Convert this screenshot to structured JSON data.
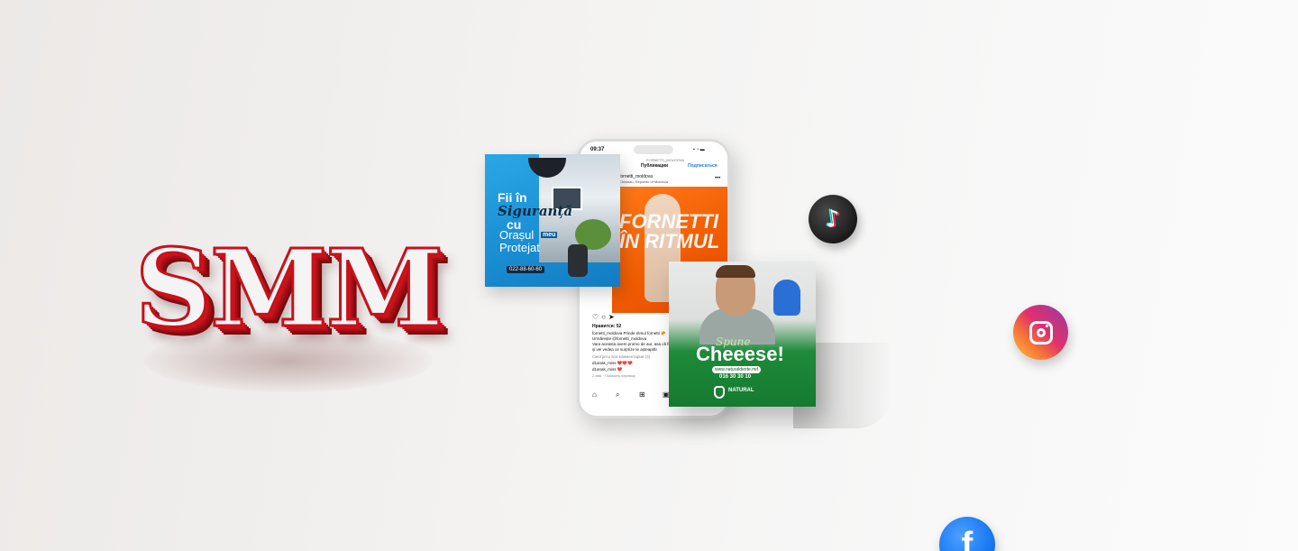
{
  "logo": {
    "text": "SMM"
  },
  "phone": {
    "time": "09:37",
    "status": "▪ ◔ ▬",
    "account": "FORNETTI_MOLDOVA",
    "header_title": "Публикации",
    "subscribe": "Подписаться",
    "handle": "fornetti_moldova",
    "location": "Chisinau, Republic of Moldova",
    "post_title": "FORNETTI ÎN RITMUL",
    "likes": "Нравится: 52",
    "caption": [
      "fornetti_moldova Prinde ritmul fornetti 🥐",
      "Urmărește @fornetti_moldova",
      "Vara aceasta avem promo de aur, asa că fii",
      "și vei vedea ce surprize te așteaptă!"
    ],
    "view_comments": "Смотреть все комментарии (3)",
    "comments": [
      "d1anak_miss ❤️❤️❤️",
      "d1anak_miss ❤️"
    ],
    "time_ago": "2 мая · Показать перевод"
  },
  "security_post": {
    "line1": "Fii în",
    "line2": "Siguranță",
    "line3": "cu",
    "line4": "Orașul",
    "badge": "meu",
    "line5": "Protejat",
    "phone": "022-88-60-60"
  },
  "dentist_post": {
    "subtitle": "Spune",
    "title": "Cheeese!",
    "site": "www.naturaldente.md",
    "phone": "016 30 30 10",
    "brand": "NATURAL"
  },
  "social": {
    "tiktok": "tiktok-icon",
    "instagram": "instagram-icon",
    "facebook": "facebook-icon",
    "facebook_glyph": "f",
    "tiktok_glyph": "♪"
  },
  "colors": {
    "logo_red": "#c8101a",
    "security_blue": "#1a8fd4",
    "fornetti_orange": "#f05a00",
    "dentist_green": "#1e8a3a"
  }
}
